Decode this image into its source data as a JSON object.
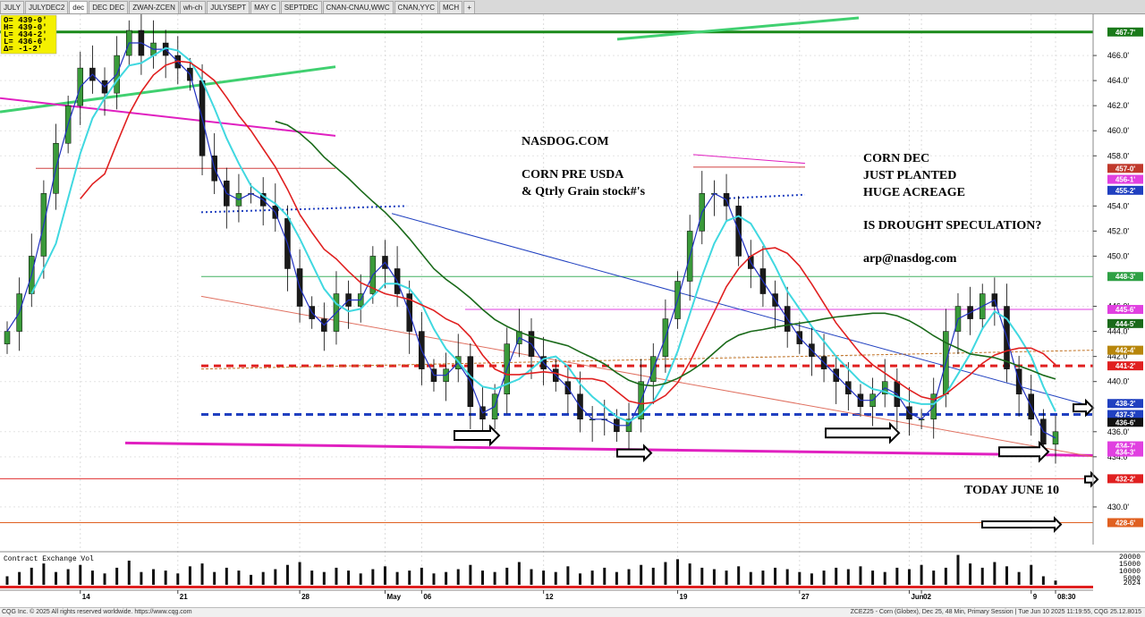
{
  "tabs": [
    "JULY",
    "JULYDEC2",
    "dec",
    "DEC DEC",
    "ZWAN-ZCEN",
    "wh-ch",
    "JULYSEPT",
    "MAY C",
    "SEPTDEC",
    "CNAN-CNAU,WWC",
    "CNAN,YYC",
    "MCH",
    "+"
  ],
  "active_tab": 2,
  "ohlc_box": [
    "O= 439-0'",
    "H= 439-0'",
    "L= 434-2'",
    "L= 436-6'",
    "Δ= -1-2'"
  ],
  "annotations": {
    "site": "NASDOG.COM",
    "line2": "CORN PRE USDA",
    "line3": "& Qtrly Grain  stock#'s",
    "right1": "CORN DEC",
    "right2": "JUST PLANTED",
    "right3": "HUGE ACREAGE",
    "right4": "IS DROUGHT SPECULATION?",
    "email": "arp@nasdog.com",
    "today": "TODAY JUNE 10"
  },
  "volume_title": "Contract Exchange Vol",
  "footer": {
    "left": "CQG Inc. © 2025 All rights reserved worldwide. https://www.cqg.com",
    "right": "ZCEZ25 - Corn (Globex), Dec 25, 48 Min, Primary Session | Tue Jun 10 2025 11:19:55, CQG 25.12.8015"
  },
  "chart_data": {
    "type": "candlestick",
    "symbol": "ZCEZ25 - Corn (Globex), Dec 25",
    "interval": "48 Min",
    "ylim": [
      427,
      469
    ],
    "y_ticks": [
      {
        "v": 466,
        "label": "466.0'"
      },
      {
        "v": 464,
        "label": "464.0'"
      },
      {
        "v": 462,
        "label": "462.0'"
      },
      {
        "v": 460,
        "label": "460.0'"
      },
      {
        "v": 458,
        "label": "458.0'"
      },
      {
        "v": 454,
        "label": "454.0'"
      },
      {
        "v": 452,
        "label": "452.0'"
      },
      {
        "v": 450,
        "label": "450.0'"
      },
      {
        "v": 446,
        "label": "446.0'"
      },
      {
        "v": 444,
        "label": "444.0'"
      },
      {
        "v": 442,
        "label": "442.0'"
      },
      {
        "v": 440,
        "label": "440.0'"
      },
      {
        "v": 436,
        "label": "436.0'"
      },
      {
        "v": 434,
        "label": "434.0'"
      },
      {
        "v": 430,
        "label": "430.0'"
      }
    ],
    "price_tags": [
      {
        "v": 467.875,
        "label": "467-7'",
        "color": "#1a7a1a"
      },
      {
        "v": 457,
        "label": "457-0'",
        "color": "#c0392b"
      },
      {
        "v": 456.125,
        "label": "456-1'",
        "color": "#e040e0"
      },
      {
        "v": 455.25,
        "label": "455-2'",
        "color": "#2040c0"
      },
      {
        "v": 448.375,
        "label": "448-3'",
        "color": "#2ea044"
      },
      {
        "v": 445.75,
        "label": "445-6'",
        "color": "#e040e0"
      },
      {
        "v": 444.625,
        "label": "444-5'",
        "color": "#1a6a1a"
      },
      {
        "v": 442.5,
        "label": "442-4'",
        "color": "#b8860b"
      },
      {
        "v": 441.25,
        "label": "441-2'",
        "color": "#e02020"
      },
      {
        "v": 438.25,
        "label": "438-2'",
        "color": "#2040c0"
      },
      {
        "v": 437.375,
        "label": "437-3'",
        "color": "#2040c0"
      },
      {
        "v": 436.75,
        "label": "436-6'",
        "color": "#111111"
      },
      {
        "v": 434.875,
        "label": "434-7'",
        "color": "#e040e0"
      },
      {
        "v": 434.375,
        "label": "434-3'",
        "color": "#e040e0"
      },
      {
        "v": 432.25,
        "label": "432-2'",
        "color": "#e02020"
      },
      {
        "v": 428.75,
        "label": "428-6'",
        "color": "#e06020"
      }
    ],
    "x_labels": [
      {
        "i": 6,
        "label": "14"
      },
      {
        "i": 14,
        "label": "21"
      },
      {
        "i": 24,
        "label": "28"
      },
      {
        "i": 31,
        "label": "May"
      },
      {
        "i": 34,
        "label": "06"
      },
      {
        "i": 44,
        "label": "12"
      },
      {
        "i": 55,
        "label": "19"
      },
      {
        "i": 65,
        "label": "27"
      },
      {
        "i": 74,
        "label": "Jun"
      },
      {
        "i": 75,
        "label": "02"
      },
      {
        "i": 84,
        "label": "9"
      },
      {
        "i": 86,
        "label": "08:30"
      }
    ],
    "close": [
      444,
      447,
      450,
      455,
      459,
      462,
      465,
      464,
      463,
      466,
      468,
      466,
      467,
      466,
      465,
      464,
      458,
      456,
      454,
      455,
      455,
      454,
      453,
      449,
      446,
      445,
      444,
      447,
      446,
      447,
      450,
      449,
      447,
      444,
      441,
      440,
      441,
      442,
      438,
      437,
      439,
      443,
      444,
      442,
      441,
      440,
      439,
      437,
      437,
      437,
      436,
      437,
      440,
      442,
      445,
      448,
      452,
      455,
      455,
      454,
      450,
      449,
      447,
      446,
      444,
      443,
      442,
      441,
      440,
      439,
      438,
      439,
      440,
      438,
      437,
      437,
      439,
      444,
      446,
      445,
      447,
      446,
      441,
      439,
      437,
      435,
      436
    ],
    "volume_ticks": [
      {
        "v": 20000,
        "label": "20000"
      },
      {
        "v": 15000,
        "label": "15000"
      },
      {
        "v": 10000,
        "label": "10000"
      },
      {
        "v": 5000,
        "label": "5000"
      },
      {
        "v": 2024,
        "label": "2024"
      }
    ],
    "volume_max": 22000,
    "volume": [
      6000,
      9000,
      12000,
      15000,
      9000,
      11000,
      14000,
      10000,
      8000,
      12000,
      17000,
      9000,
      11000,
      10000,
      8000,
      13000,
      15000,
      9000,
      12000,
      10000,
      7000,
      9000,
      11000,
      14000,
      16000,
      10000,
      9000,
      12000,
      10000,
      8000,
      11000,
      13000,
      9000,
      10000,
      12000,
      8000,
      9000,
      11000,
      14000,
      10000,
      9000,
      12000,
      16000,
      11000,
      10000,
      9000,
      13000,
      8000,
      10000,
      12000,
      9000,
      11000,
      14000,
      12000,
      16000,
      18000,
      15000,
      12000,
      11000,
      10000,
      13000,
      9000,
      10000,
      12000,
      11000,
      9000,
      8000,
      10000,
      12000,
      11000,
      13000,
      10000,
      9000,
      12000,
      11000,
      14000,
      10000,
      12000,
      21000,
      15000,
      12000,
      16000,
      13000,
      9000,
      14000,
      6000,
      3000
    ],
    "grid": true,
    "legend": "none"
  }
}
